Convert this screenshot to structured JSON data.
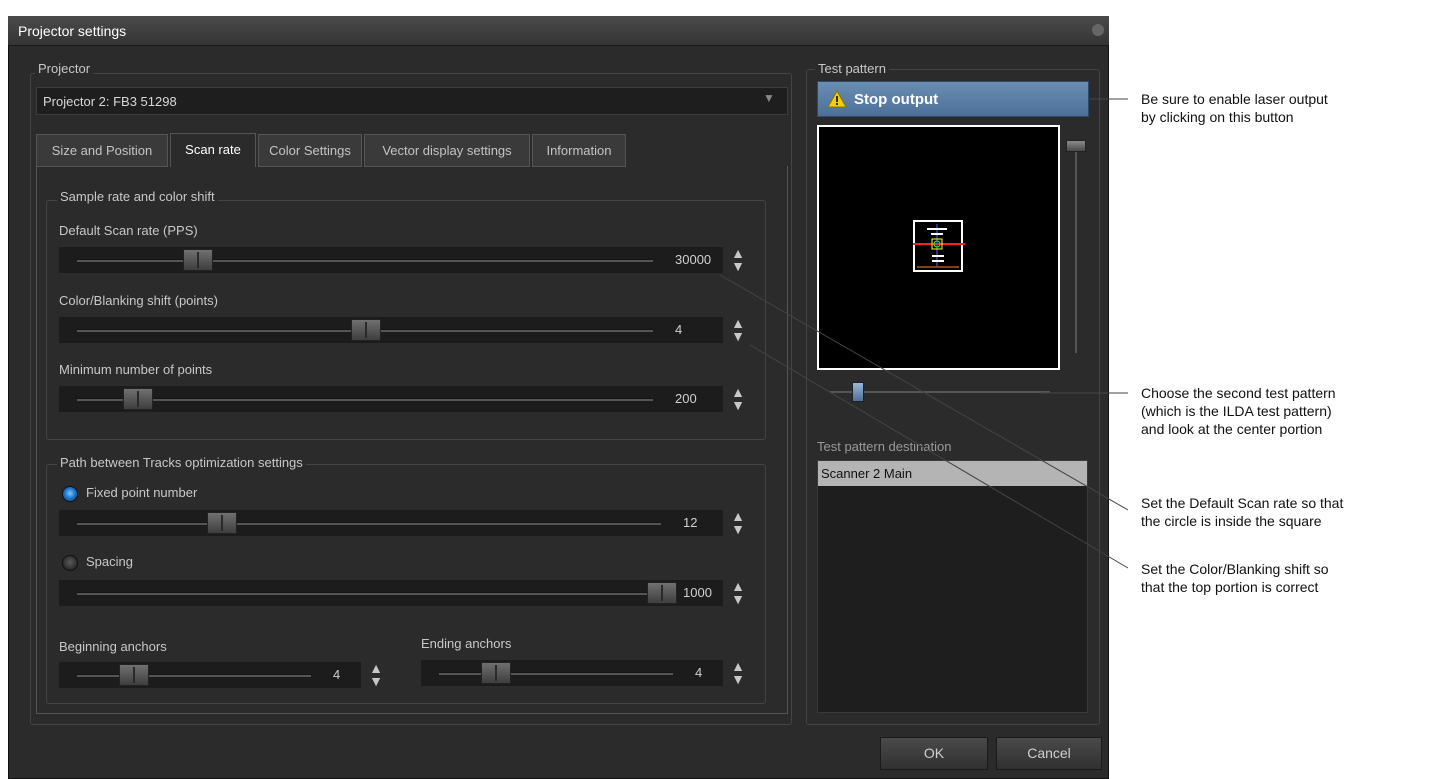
{
  "window": {
    "title": "Projector settings"
  },
  "projector": {
    "label": "Projector",
    "selected": "Projector 2: FB3 51298"
  },
  "tabs": [
    {
      "label": "Size and Position"
    },
    {
      "label": "Scan rate",
      "active": true
    },
    {
      "label": "Color Settings"
    },
    {
      "label": "Vector display settings"
    },
    {
      "label": "Information"
    }
  ],
  "sample_group": {
    "title": "Sample rate and color shift",
    "scan_rate": {
      "label": "Default Scan rate (PPS)",
      "value": "30000"
    },
    "color_shift": {
      "label": "Color/Blanking shift (points)",
      "value": "4"
    },
    "min_points": {
      "label": "Minimum number of points",
      "value": "200"
    }
  },
  "path_group": {
    "title": "Path between Tracks optimization settings",
    "fixed_point": {
      "label": "Fixed point number",
      "value": "12",
      "selected": true
    },
    "spacing": {
      "label": "Spacing",
      "value": "1000",
      "selected": false
    },
    "begin_anchors": {
      "label": "Beginning anchors",
      "value": "4"
    },
    "end_anchors": {
      "label": "Ending anchors",
      "value": "4"
    }
  },
  "test_pattern": {
    "label": "Test pattern",
    "stop_button": "Stop output",
    "destination_label": "Test pattern destination",
    "destinations": [
      "Scanner 2 Main"
    ]
  },
  "buttons": {
    "ok": "OK",
    "cancel": "Cancel"
  },
  "annotations": [
    "Be sure to enable laser output\nby clicking on this button",
    "Choose the second test pattern\n(which is the ILDA test pattern)\nand look at the center portion",
    "Set the Default Scan rate so that\nthe circle is inside the square",
    "Set the Color/Blanking shift so\nthat the top portion is correct"
  ],
  "colors": {
    "stop_button_bg": "#5a7fa6",
    "warning_icon": "#f5d000",
    "dialog_bg": "#2b2b2b"
  }
}
